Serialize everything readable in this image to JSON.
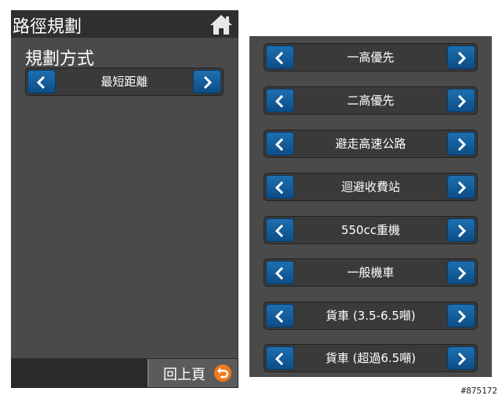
{
  "left_screen": {
    "title": "路徑規劃",
    "section_label": "規劃方式",
    "selector_value": "最短距離",
    "back_label": "回上頁"
  },
  "right_screen": {
    "options": [
      "一高優先",
      "二高優先",
      "避走高速公路",
      "迴避收費站",
      "550cc重機",
      "一般機車",
      "貨車 (3.5-6.5噸)",
      "貨車 (超過6.5噸)"
    ]
  },
  "icons": {
    "home": "home-icon",
    "back": "undo-icon",
    "left_arrow": "chevron-left-icon",
    "right_arrow": "chevron-right-icon"
  },
  "colors": {
    "screen_bg": "#4a4a4a",
    "title_bar": "#2f2f2f",
    "arrow_blue": "#1565a8",
    "back_orange": "#f07a1e"
  },
  "watermark": "#875172"
}
